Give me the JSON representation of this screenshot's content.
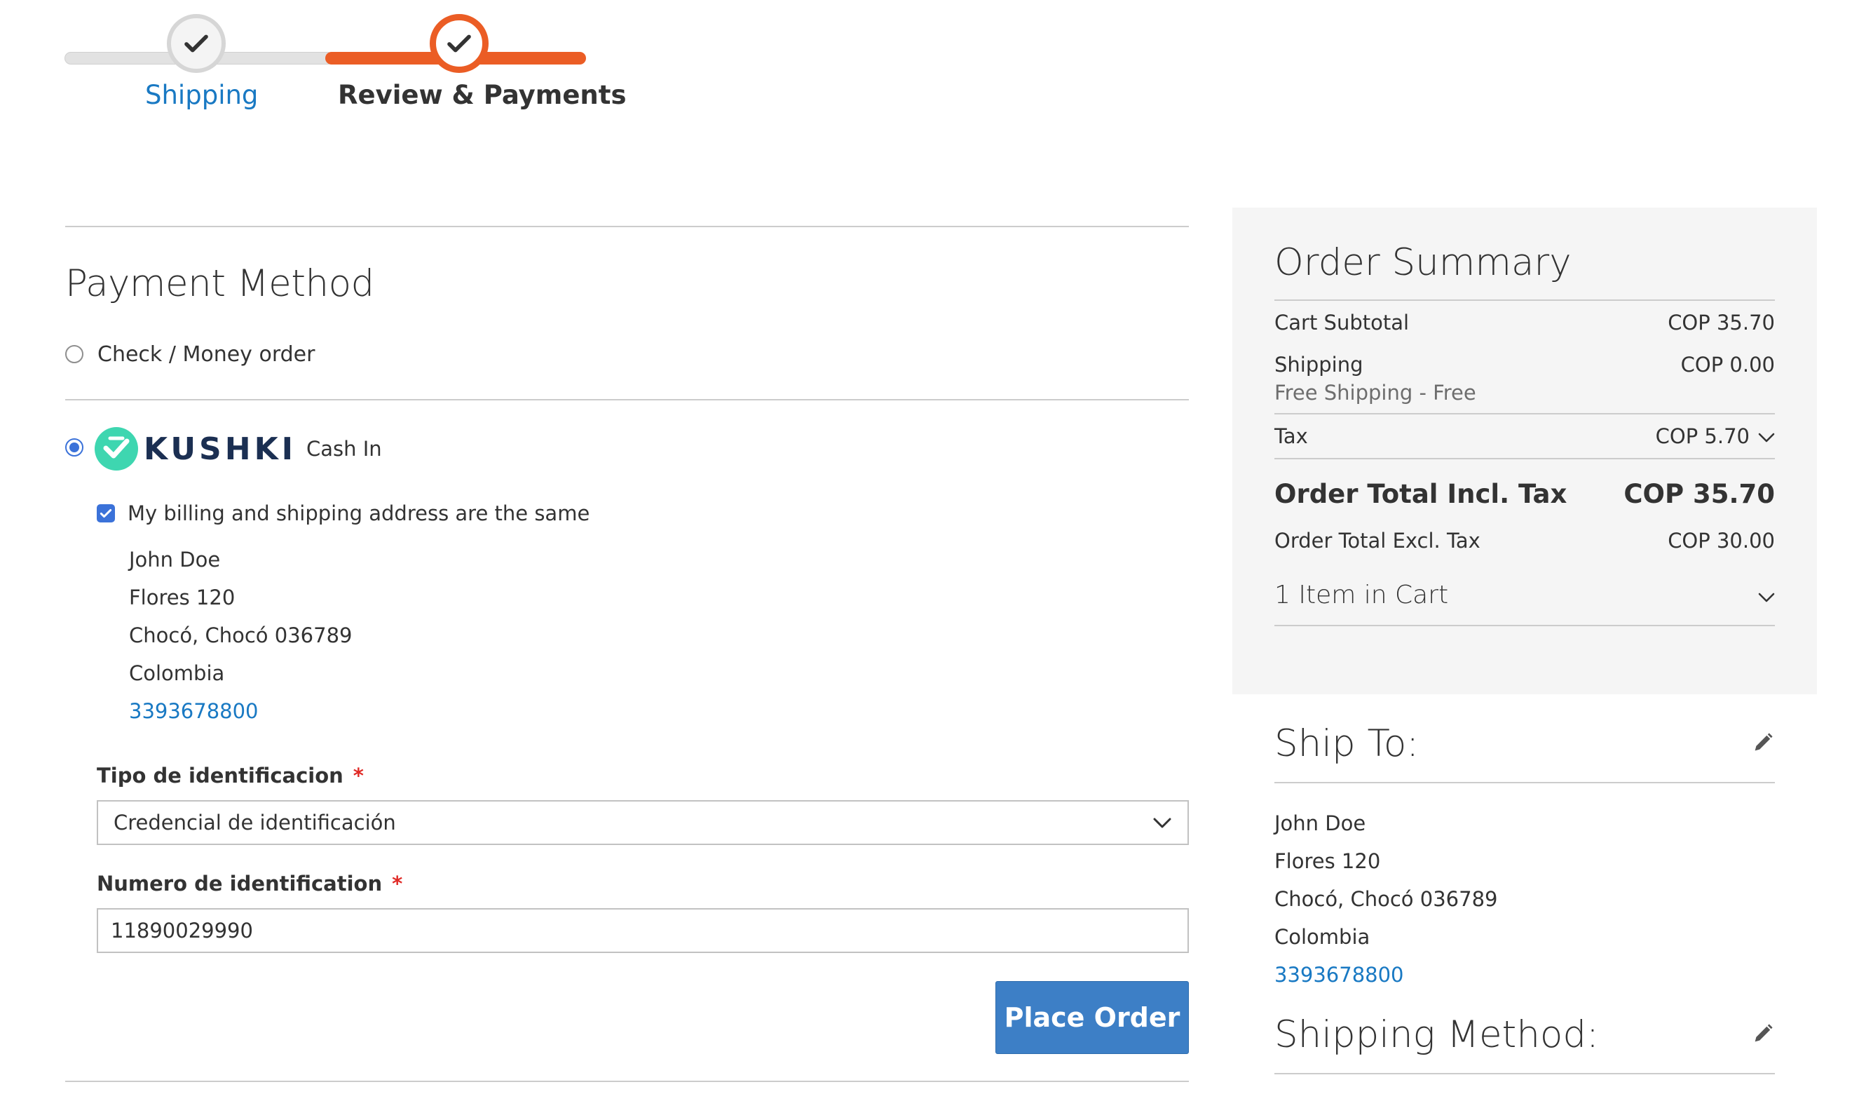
{
  "progress": {
    "steps": [
      {
        "label": "Shipping",
        "state": "complete"
      },
      {
        "label": "Review & Payments",
        "state": "active"
      }
    ],
    "colors": {
      "active": "#eb5d25",
      "inactive": "#e2e2e2",
      "link": "#1979c3"
    }
  },
  "payment": {
    "title": "Payment Method",
    "methods": [
      {
        "label": "Check / Money order",
        "selected": false
      },
      {
        "brand": "KUSHKI",
        "label": "Cash In",
        "selected": true
      }
    ],
    "same_address_label": "My billing and shipping address are the same",
    "same_address_checked": true,
    "billing_address": {
      "name": "John Doe",
      "street": "Flores 120",
      "city": "Chocó, Chocó 036789",
      "country": "Colombia",
      "phone": "3393678800"
    },
    "id_type": {
      "label": "Tipo de identificacion",
      "required_mark": "*",
      "value": "Credencial de identificación"
    },
    "id_number": {
      "label": "Numero de identification",
      "required_mark": "*",
      "value": "11890029990"
    },
    "place_order_label": "Place Order"
  },
  "summary": {
    "title": "Order Summary",
    "subtotal": {
      "label": "Cart Subtotal",
      "value": "COP 35.70"
    },
    "shipping": {
      "label": "Shipping",
      "value": "COP 0.00",
      "detail": "Free Shipping - Free"
    },
    "tax": {
      "label": "Tax",
      "value": "COP 5.70"
    },
    "total_incl": {
      "label": "Order Total Incl. Tax",
      "value": "COP 35.70"
    },
    "total_excl": {
      "label": "Order Total Excl. Tax",
      "value": "COP 30.00"
    },
    "cart_items": "1 Item in Cart"
  },
  "ship_to": {
    "title": "Ship To:",
    "address": {
      "name": "John Doe",
      "street": "Flores 120",
      "city": "Chocó, Chocó 036789",
      "country": "Colombia",
      "phone": "3393678800"
    }
  },
  "shipping_method": {
    "title": "Shipping Method:"
  },
  "colors": {
    "primary_button": "#3d7fc6",
    "link": "#1979c3",
    "required": "#e02b27",
    "summary_bg": "#f5f5f5",
    "kushki_green": "#3ed6b0",
    "kushki_navy": "#1b2f52"
  }
}
